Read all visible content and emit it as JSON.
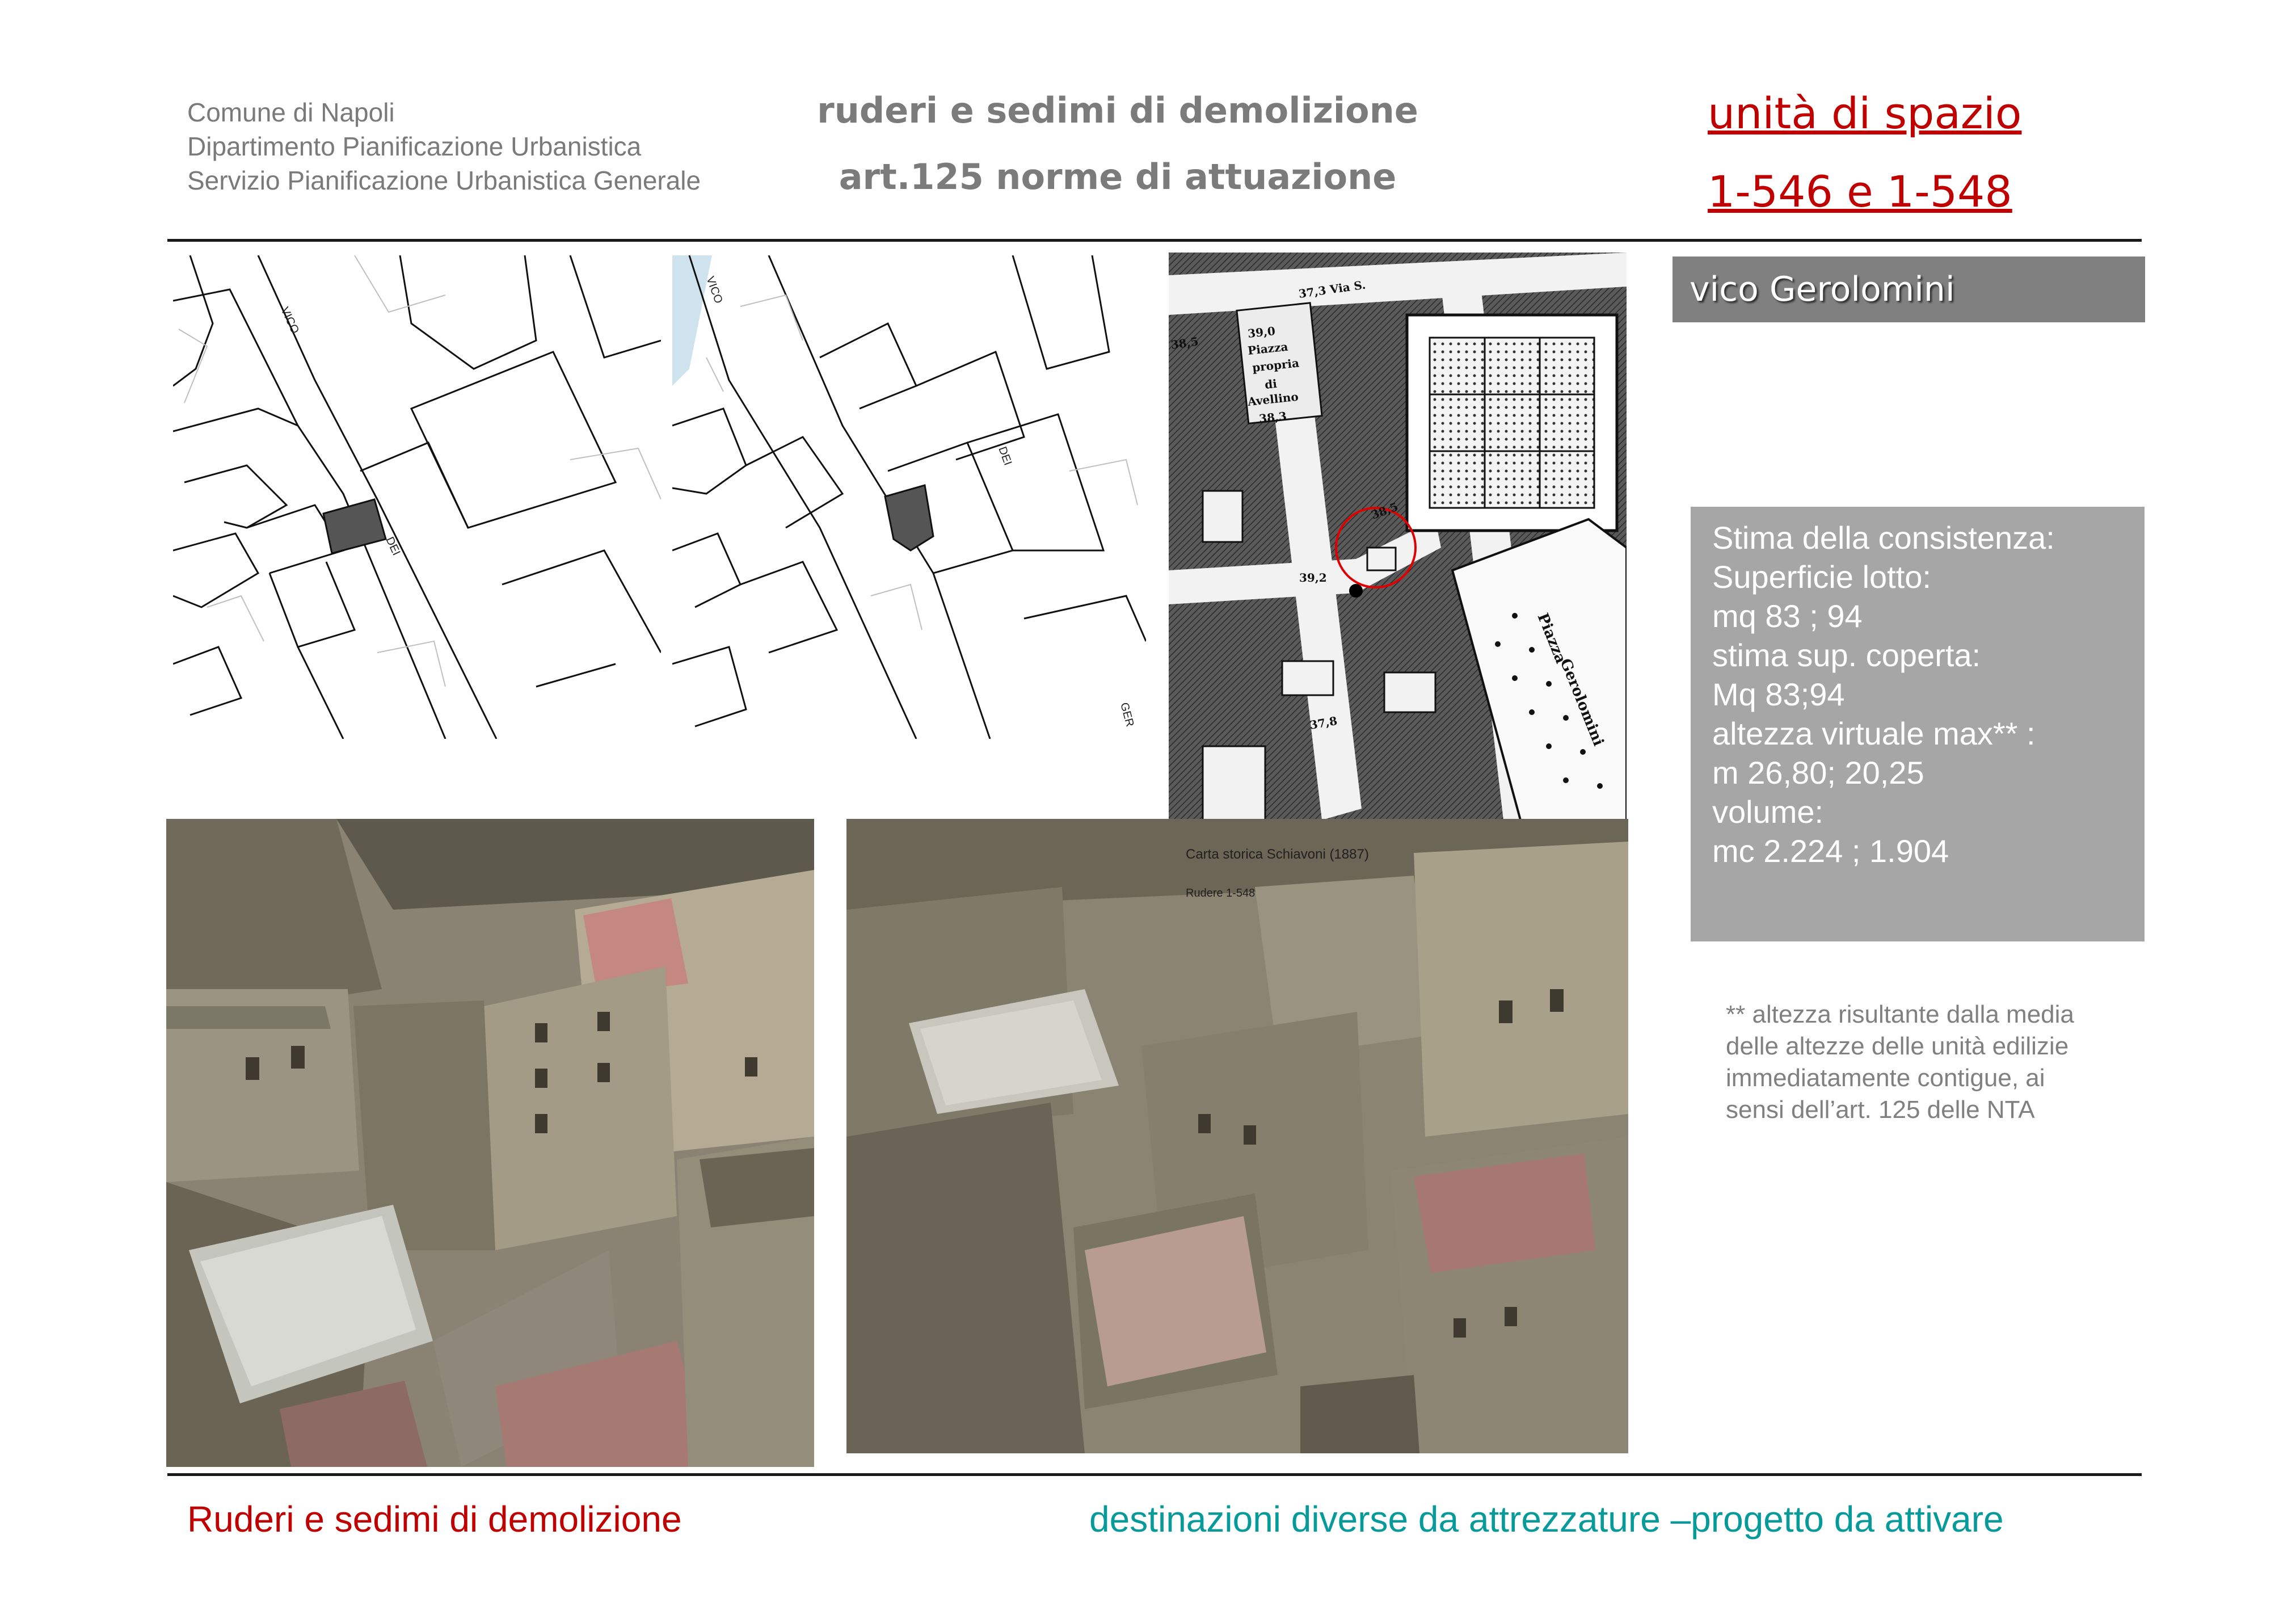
{
  "header": {
    "org_lines": [
      "Comune di Napoli",
      "Dipartimento Pianificazione Urbanistica",
      "Servizio Pianificazione Urbanistica Generale"
    ],
    "title": "ruderi e sedimi di demolizione",
    "subtitle": "art.125 norme di attuazione",
    "unit_label": "unità di spazio",
    "unit_ids": "1-546 e 1-548"
  },
  "street_name": "vico Gerolomini",
  "maps": {
    "map1_labels": [
      "VICO",
      "DEI"
    ],
    "map2_labels": [
      "VICO",
      "DEI",
      "GER"
    ],
    "historic_labels": [
      "38,5",
      "39,0",
      "Piazza",
      "propria",
      "di",
      "Avellino",
      "38,3",
      "37,3 Via S.",
      "38,5",
      "39,2",
      "37,8",
      "Piazza",
      "Gerolomini"
    ],
    "historic_caption": "Carta storica Schiavoni (1887)",
    "ruin_caption": "Rudere 1-548"
  },
  "stats": {
    "lines": [
      "Stima della consistenza:",
      "Superficie lotto:",
      "mq 83 ; 94",
      "stima sup. coperta:",
      "Mq 83;94",
      "altezza virtuale max** :",
      "m 26,80; 20,25",
      "volume:",
      "mc 2.224 ; 1.904"
    ]
  },
  "note_lines": [
    "** altezza risultante dalla media",
    "delle altezze delle unità edilizie",
    "immediatamente contigue, ai",
    "sensi dell’art. 125 delle NTA"
  ],
  "footer": {
    "left": "Ruderi e sedimi di demolizione",
    "right": "destinazioni diverse da  attrezzature –progetto da attivare"
  },
  "colors": {
    "accent_red": "#c00000",
    "teal": "#079a9a",
    "header_grey": "#7b7b7b",
    "panel_grey": "#a6a6a6",
    "street_grey": "#808080"
  }
}
